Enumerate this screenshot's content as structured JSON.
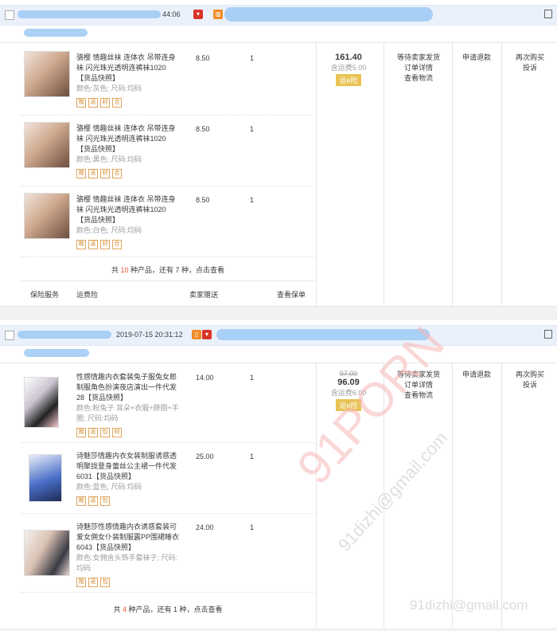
{
  "orders": [
    {
      "header_time": "44:06",
      "total": "161.40",
      "shipping": "含运费5.00",
      "insurance": "运e险",
      "status": [
        "等待卖家发货",
        "订单详情",
        "查看物流"
      ],
      "refund": "申请退款",
      "actions": [
        "再次购买",
        "投诉"
      ],
      "items": [
        {
          "title": "骆樱 情趣丝袜 连体衣 吊带连身袜 闪光珠光透明连裤袜1020",
          "snapshot": "【货品快照】",
          "attr": "颜色:灰色;  尺码:均码",
          "price": "8.50",
          "qty": "1"
        },
        {
          "title": "骆樱 情趣丝袜 连体衣 吊带连身袜 闪光珠光透明连裤袜1020",
          "snapshot": "【货品快照】",
          "attr": "颜色:黑色;  尺码:均码",
          "price": "8.50",
          "qty": "1"
        },
        {
          "title": "骆樱 情趣丝袜 连体衣 吊带连身袜 闪光珠光透明连裤袜1020",
          "snapshot": "【货品快照】",
          "attr": "颜色:白色;  尺码:均码",
          "price": "8.50",
          "qty": "1"
        }
      ],
      "badges": [
        "赠",
        "返",
        "材",
        "合"
      ],
      "more_prefix": "共",
      "more_count": "10",
      "more_suffix": "种产品，还有 7 种，点击查看",
      "services": [
        "保险服务",
        "运费险",
        "卖家赠送",
        "查看保单"
      ]
    },
    {
      "header_time": "2019-07-15 20:31:12",
      "total": "96.09",
      "old_total": "97.00",
      "shipping": "含运费6.00",
      "insurance": "运e险",
      "status": [
        "等待卖家发货",
        "订单详情",
        "查看物流"
      ],
      "refund": "申请退款",
      "actions": [
        "再次购买",
        "投诉"
      ],
      "items": [
        {
          "title": "性感情趣内衣套装兔子服兔女郎制服角色扮演夜店演出一件代发28",
          "snapshot": "【货品快照】",
          "attr": "颜色:粉兔子 耳朵+衣服+脖圈+手圈;  尺码:均码",
          "price": "14.00",
          "qty": "1"
        },
        {
          "title": "诗魅莎情趣内衣女装制服诱惑透明聚拢登身蕾丝公主裙一件代发6031",
          "snapshot": "【货品快照】",
          "attr": "颜色:蓝色;  尺码:均码",
          "price": "25.00",
          "qty": "1"
        },
        {
          "title": "诗魅莎性感情趣内衣诱惑套装可爱女佣女仆装制服露PP围裙睡衣6043",
          "snapshot": "【货品快照】",
          "attr": "颜色:女佣含头饰手套袜子;  尺码:均码",
          "price": "24.00",
          "qty": "1"
        }
      ],
      "badges": [
        "赠",
        "返",
        "包",
        "材"
      ],
      "more_prefix": "共",
      "more_count": "4",
      "more_suffix": "种产品，还有 1 种，点击查看"
    }
  ],
  "watermark": {
    "big": "91PORN",
    "email_diag": "91dizhi@gmail.com",
    "email_bottom": "91dizhi@gmail.com"
  }
}
